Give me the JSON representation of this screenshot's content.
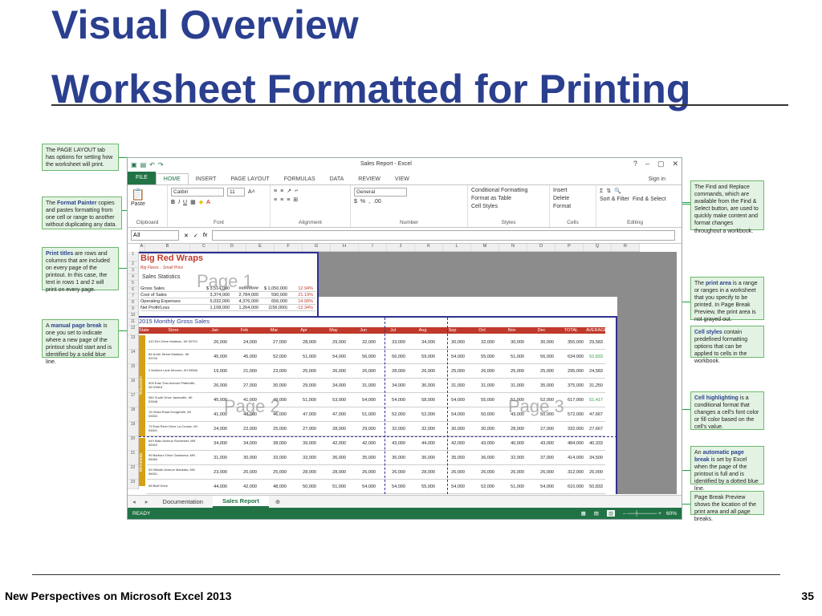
{
  "slide": {
    "title_line1": "Visual Overview",
    "title_line2": "Worksheet Formatted for Printing",
    "footer_left": "New Perspectives on Microsoft Excel 2013",
    "page_number": "35"
  },
  "callouts": {
    "page_layout": "The PAGE LAYOUT tab has options for setting how the worksheet will print.",
    "format_painter_pre": "The ",
    "format_painter_hl": "Format Painter",
    "format_painter_post": " copies and pastes formatting from one cell or range to another without duplicating any data.",
    "print_titles_hl": "Print titles",
    "print_titles_post": " are rows and columns that are included on every page of the printout. In this case, the text in rows 1 and 2 will print on every page.",
    "manual_break_pre": "A ",
    "manual_break_hl": "manual page break",
    "manual_break_post": " is one you set to indicate where a new page of the printout should start and is identified by a solid blue line.",
    "find_replace": "The Find and Replace commands, which are available from the Find & Select button, are used to quickly make content and format changes throughout a workbook.",
    "print_area_pre": "The ",
    "print_area_hl": "print area",
    "print_area_post": " is a range or ranges in a worksheet that you specify to be printed. In Page Break Preview, the print area is not grayed out.",
    "cell_styles_hl": "Cell styles",
    "cell_styles_post": " contain predefined formatting options that can be applied to cells in the workbook.",
    "cell_highlight_hl": "Cell highlighting",
    "cell_highlight_post": " is a conditional format that changes a cell's font color or fill color based on the cell's value.",
    "auto_break_pre": "An ",
    "auto_break_hl": "automatic page break",
    "auto_break_post": " is set by Excel when the page of the printout is full and is identified by a dotted blue line.",
    "page_break_preview": "Page Break Preview shows the location of the print area and all page breaks."
  },
  "excel": {
    "window_title": "Sales Report - Excel",
    "win_help": "?",
    "win_min": "–",
    "win_max": "▢",
    "win_close": "✕",
    "tabs": [
      "FILE",
      "HOME",
      "INSERT",
      "PAGE LAYOUT",
      "FORMULAS",
      "DATA",
      "REVIEW",
      "VIEW"
    ],
    "sign_in": "Sign in",
    "font_name": "Calibri",
    "font_size": "11",
    "number_format": "General",
    "groups": {
      "clipboard": "Clipboard",
      "font": "Font",
      "alignment": "Alignment",
      "number": "Number",
      "styles": "Styles",
      "cells": "Cells",
      "editing": "Editing"
    },
    "paste": "Paste",
    "conditional_formatting": "Conditional Formatting",
    "format_as_table": "Format as Table",
    "cell_styles": "Cell Styles",
    "insert": "Insert",
    "delete": "Delete",
    "format": "Format",
    "sort_filter": "Sort & Filter",
    "find_select": "Find & Select",
    "name_box": "A3",
    "fx": "fx",
    "columns": [
      "A",
      "B",
      "C",
      "D",
      "E",
      "F",
      "G",
      "H",
      "I",
      "J",
      "K",
      "L",
      "M",
      "N",
      "O",
      "P",
      "Q",
      "R"
    ],
    "rows": [
      "1",
      "2",
      "3",
      "4",
      "5",
      "6",
      "7",
      "8",
      "9",
      "10",
      "11",
      "12",
      "13",
      "14",
      "15",
      "16",
      "17",
      "18",
      "19",
      "20",
      "21",
      "22",
      "23"
    ],
    "sheet_title": "Big Red Wraps",
    "sheet_subtitle": "Big Flavor... Small Price",
    "sales_statistics": "Sales Statistics",
    "stat_rows": [
      {
        "label": "Gross Sales",
        "v1": "$ 3,514,000",
        "v2": "########",
        "v3": "$ 1,050,000",
        "v4": "12.94%"
      },
      {
        "label": "Cost of Sales",
        "v1": "3,374,000",
        "v2": "2,784,000",
        "v3": "590,000",
        "v4": "21.19%"
      },
      {
        "label": "Operating Expenses",
        "v1": "5,032,000",
        "v2": "4,376,000",
        "v3": "656,000",
        "v4": "14.99%"
      },
      {
        "label": "Net Profit/Loss",
        "v1": "1,108,000",
        "v2": "1,264,000",
        "v3": "(156,000)",
        "v4": "-12.34%"
      }
    ],
    "monthly_title": "2015 Monthly Gross Sales",
    "monthly_headers": [
      "State",
      "Store",
      "Jan",
      "Feb",
      "Mar",
      "Apr",
      "May",
      "Jun",
      "Jul",
      "Aug",
      "Sep",
      "Oct",
      "Nov",
      "Dec",
      "TOTAL",
      "AVERAGE"
    ],
    "monthly_rows": [
      {
        "addr": "410 Elm Drive Madison, WI 53703",
        "vals": [
          "26,000",
          "24,000",
          "27,000",
          "28,000",
          "29,000",
          "32,000",
          "33,000",
          "34,000",
          "30,000",
          "32,000",
          "30,000",
          "30,000",
          "355,000",
          "29,583"
        ]
      },
      {
        "addr": "84 North Street Madison, WI 53704",
        "vals": [
          "45,000",
          "45,000",
          "52,000",
          "51,000",
          "54,000",
          "56,000",
          "56,000",
          "59,000",
          "54,000",
          "55,000",
          "51,000",
          "56,000",
          "634,000",
          "52,833"
        ]
      },
      {
        "addr": "2 Ashford Lane Monroe, WI 53566",
        "vals": [
          "19,000",
          "21,000",
          "23,000",
          "25,000",
          "26,000",
          "26,000",
          "28,000",
          "26,000",
          "25,000",
          "26,000",
          "25,000",
          "25,000",
          "295,000",
          "24,583"
        ]
      },
      {
        "addr": "505 East Tran Avenue Platteville, WI 53818",
        "vals": [
          "26,000",
          "27,000",
          "30,000",
          "29,000",
          "34,000",
          "31,000",
          "34,000",
          "36,000",
          "31,000",
          "31,000",
          "31,000",
          "35,000",
          "375,000",
          "31,250"
        ]
      },
      {
        "addr": "982 South Drive Janesville, WI 53548",
        "vals": [
          "45,000",
          "41,000",
          "49,000",
          "51,000",
          "53,000",
          "54,000",
          "54,000",
          "58,000",
          "54,000",
          "55,000",
          "51,000",
          "52,000",
          "617,000",
          "51,417"
        ]
      },
      {
        "addr": "19 Vesta Road Dodgeville, WI 53533",
        "vals": [
          "41,000",
          "48,000",
          "46,000",
          "47,000",
          "47,000",
          "51,000",
          "52,000",
          "52,000",
          "54,000",
          "50,000",
          "43,000",
          "50,000",
          "572,000",
          "47,667"
        ]
      },
      {
        "addr": "79 East River Drive La Crosse, WI 54601",
        "vals": [
          "24,000",
          "22,000",
          "25,000",
          "27,000",
          "28,000",
          "29,000",
          "32,000",
          "32,000",
          "30,000",
          "30,000",
          "28,000",
          "27,000",
          "332,000",
          "27,667"
        ]
      },
      {
        "addr": "649 Main Avenue Rochester, MN 55902",
        "vals": [
          "34,000",
          "34,000",
          "38,000",
          "39,000",
          "42,000",
          "42,000",
          "43,000",
          "44,000",
          "42,000",
          "43,000",
          "40,000",
          "43,000",
          "484,000",
          "40,333"
        ]
      },
      {
        "addr": "99 Barbour Drive Owatonna, MN 55060",
        "vals": [
          "31,000",
          "30,000",
          "33,000",
          "33,000",
          "36,000",
          "35,000",
          "36,000",
          "36,000",
          "35,000",
          "36,000",
          "32,000",
          "37,000",
          "414,000",
          "34,500"
        ]
      },
      {
        "addr": "53 Hillside Avenue Mankato, MN 56001",
        "vals": [
          "23,000",
          "20,000",
          "25,000",
          "28,000",
          "28,000",
          "26,000",
          "26,000",
          "28,000",
          "26,000",
          "26,000",
          "26,000",
          "26,000",
          "312,000",
          "26,000"
        ]
      },
      {
        "addr": "98 Bluff Drive",
        "vals": [
          "44,000",
          "42,000",
          "48,000",
          "50,000",
          "51,000",
          "54,000",
          "54,000",
          "55,000",
          "54,000",
          "52,000",
          "51,000",
          "54,000",
          "610,000",
          "50,833"
        ]
      }
    ],
    "state_wi": "Wisconsin",
    "state_mn": "Minnesota",
    "page1": "Page 1",
    "page2": "Page 2",
    "page3": "Page 3",
    "sheet_tab1": "Documentation",
    "sheet_tab2": "Sales Report",
    "status": "READY",
    "zoom": "60%"
  }
}
